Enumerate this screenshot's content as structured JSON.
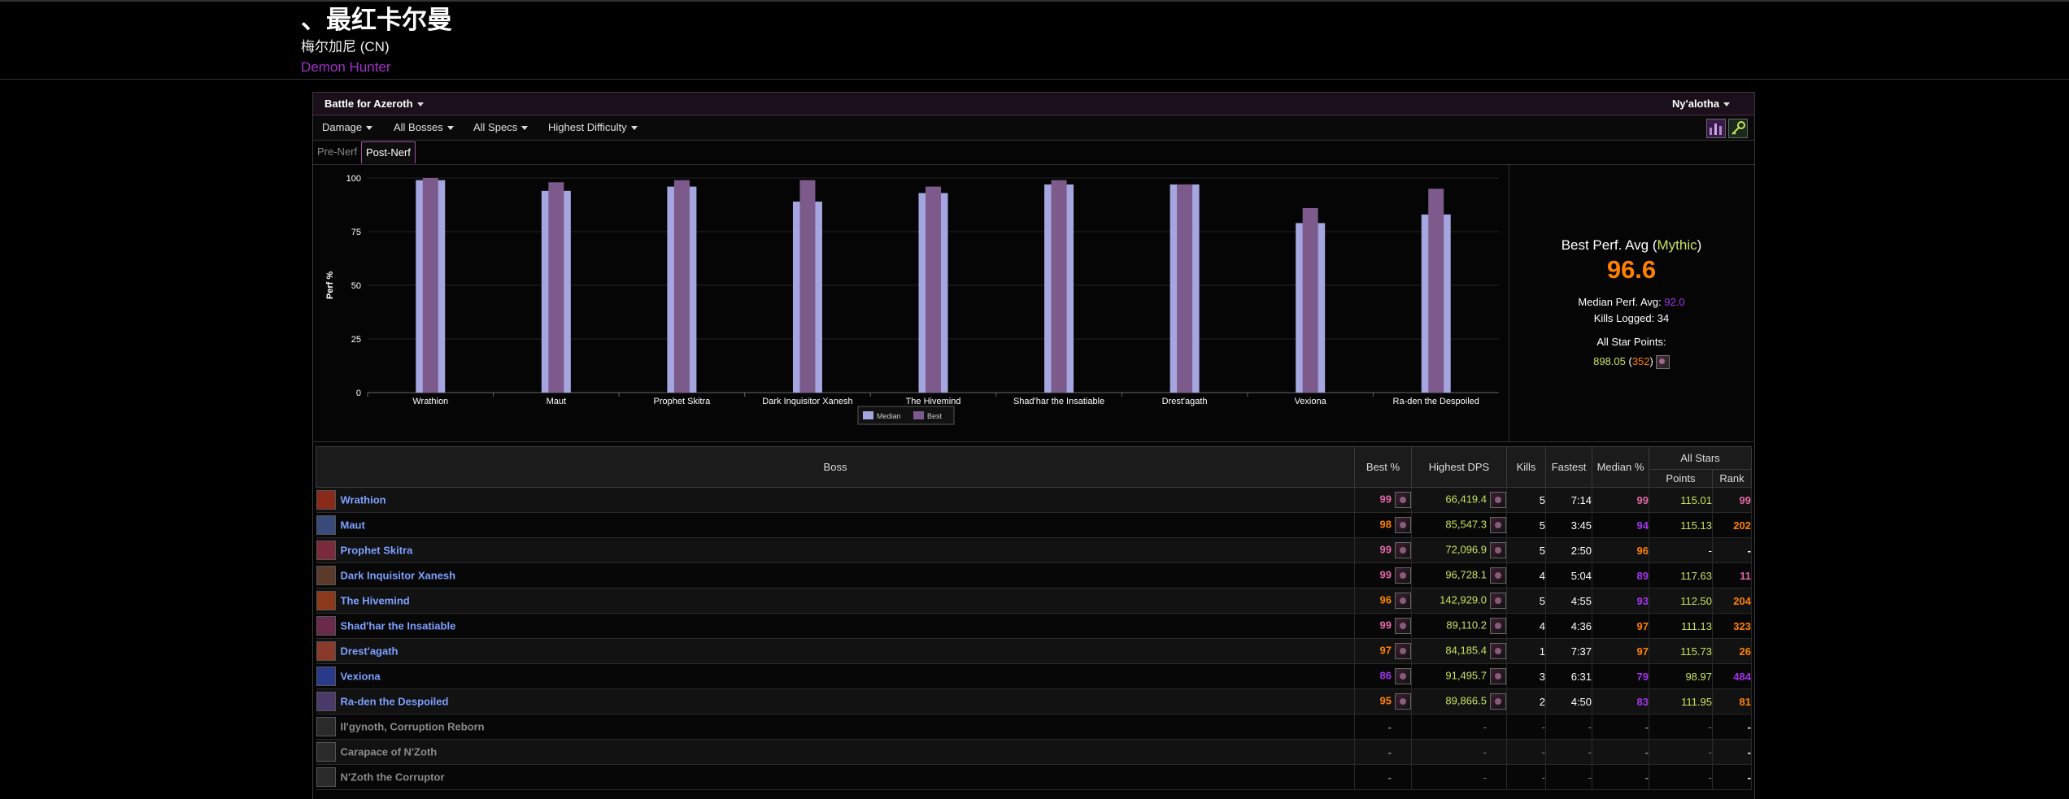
{
  "character": {
    "name": "、最红卡尔曼",
    "server": "梅尔加尼 (CN)",
    "class": "Demon Hunter"
  },
  "expansion_select": "Battle for Azeroth",
  "raid_select": "Ny'alotha",
  "filters": [
    "Damage",
    "All Bosses",
    "All Specs",
    "Highest Difficulty"
  ],
  "tabs": [
    "Pre-Nerf",
    "Post-Nerf"
  ],
  "active_tab": "Post-Nerf",
  "stats": {
    "best_perf_label": "Best Perf. Avg",
    "difficulty": "Mythic",
    "best_perf_value": "96.6",
    "median_label": "Median Perf. Avg:",
    "median_value": "92.0",
    "kills_label": "Kills Logged:",
    "kills_value": "34",
    "all_star_label": "All Star Points:",
    "all_star_points": "898.05",
    "all_star_rank": "352"
  },
  "chart_data": {
    "type": "bar",
    "ylabel": "Perf %",
    "ylim": [
      0,
      100
    ],
    "yticks": [
      0,
      25,
      50,
      75,
      100
    ],
    "categories": [
      "Wrathion",
      "Maut",
      "Prophet Skitra",
      "Dark Inquisitor Xanesh",
      "The Hivemind",
      "Shad'har the Insatiable",
      "Drest'agath",
      "Vexiona",
      "Ra-den the Despoiled"
    ],
    "series": [
      {
        "name": "Median",
        "color": "#a5a6e0",
        "values": [
          99,
          94,
          96,
          89,
          93,
          97,
          97,
          79,
          83
        ]
      },
      {
        "name": "Best",
        "color": "#7c5a8c",
        "values": [
          100,
          98,
          99,
          99,
          96,
          99,
          97,
          86,
          95
        ]
      }
    ],
    "legend_position": "bottom"
  },
  "table": {
    "headers": {
      "boss": "Boss",
      "best": "Best %",
      "dps": "Highest DPS",
      "kills": "Kills",
      "fastest": "Fastest",
      "median": "Median %",
      "allstars": "All Stars",
      "points": "Points",
      "rank": "Rank"
    },
    "rows": [
      {
        "name": "Wrathion",
        "active": true,
        "best": "99",
        "best_c": "pink",
        "dps": "66,419.4",
        "kills": "5",
        "fastest": "7:14",
        "median": "99",
        "median_c": "pink",
        "points": "115.01",
        "rank": "99",
        "rank_c": "pink",
        "icon": "#8a2a1a"
      },
      {
        "name": "Maut",
        "active": true,
        "best": "98",
        "best_c": "orange",
        "dps": "85,547.3",
        "kills": "5",
        "fastest": "3:45",
        "median": "94",
        "median_c": "purple",
        "points": "115.13",
        "rank": "202",
        "rank_c": "orange",
        "icon": "#3a4a7a"
      },
      {
        "name": "Prophet Skitra",
        "active": true,
        "best": "99",
        "best_c": "pink",
        "dps": "72,096.9",
        "kills": "5",
        "fastest": "2:50",
        "median": "96",
        "median_c": "orange",
        "points": "-",
        "rank": "-",
        "rank_c": "white",
        "icon": "#7a2a3a"
      },
      {
        "name": "Dark Inquisitor Xanesh",
        "active": true,
        "best": "99",
        "best_c": "pink",
        "dps": "96,728.1",
        "kills": "4",
        "fastest": "5:04",
        "median": "89",
        "median_c": "purple",
        "points": "117.63",
        "rank": "11",
        "rank_c": "pink",
        "icon": "#5a3a2a"
      },
      {
        "name": "The Hivemind",
        "active": true,
        "best": "96",
        "best_c": "orange",
        "dps": "142,929.0",
        "kills": "5",
        "fastest": "4:55",
        "median": "93",
        "median_c": "purple",
        "points": "112.50",
        "rank": "204",
        "rank_c": "orange",
        "icon": "#8a3a1a"
      },
      {
        "name": "Shad'har the Insatiable",
        "active": true,
        "best": "99",
        "best_c": "pink",
        "dps": "89,110.2",
        "kills": "4",
        "fastest": "4:36",
        "median": "97",
        "median_c": "orange",
        "points": "111.13",
        "rank": "323",
        "rank_c": "orange",
        "icon": "#6a2a4a"
      },
      {
        "name": "Drest'agath",
        "active": true,
        "best": "97",
        "best_c": "orange",
        "dps": "84,185.4",
        "kills": "1",
        "fastest": "7:37",
        "median": "97",
        "median_c": "orange",
        "points": "115.73",
        "rank": "26",
        "rank_c": "orange",
        "icon": "#8a3a2a"
      },
      {
        "name": "Vexiona",
        "active": true,
        "best": "86",
        "best_c": "purple",
        "dps": "91,495.7",
        "kills": "3",
        "fastest": "6:31",
        "median": "79",
        "median_c": "purple",
        "points": "98.97",
        "rank": "484",
        "rank_c": "purple",
        "icon": "#2a3a8a"
      },
      {
        "name": "Ra-den the Despoiled",
        "active": true,
        "best": "95",
        "best_c": "orange",
        "dps": "89,866.5",
        "kills": "2",
        "fastest": "4:50",
        "median": "83",
        "median_c": "purple",
        "points": "111.95",
        "rank": "81",
        "rank_c": "orange",
        "icon": "#4a3a6a"
      },
      {
        "name": "Il'gynoth, Corruption Reborn",
        "active": false,
        "best": "-",
        "dps": "-",
        "kills": "-",
        "fastest": "-",
        "median": "-",
        "points": "-",
        "rank": "-",
        "icon": "#2a2a2a"
      },
      {
        "name": "Carapace of N'Zoth",
        "active": false,
        "best": "-",
        "dps": "-",
        "kills": "-",
        "fastest": "-",
        "median": "-",
        "points": "-",
        "rank": "-",
        "icon": "#2a2a2a"
      },
      {
        "name": "N'Zoth the Corruptor",
        "active": false,
        "best": "-",
        "dps": "-",
        "kills": "-",
        "fastest": "-",
        "median": "-",
        "points": "-",
        "rank": "-",
        "icon": "#2a2a2a"
      }
    ]
  }
}
